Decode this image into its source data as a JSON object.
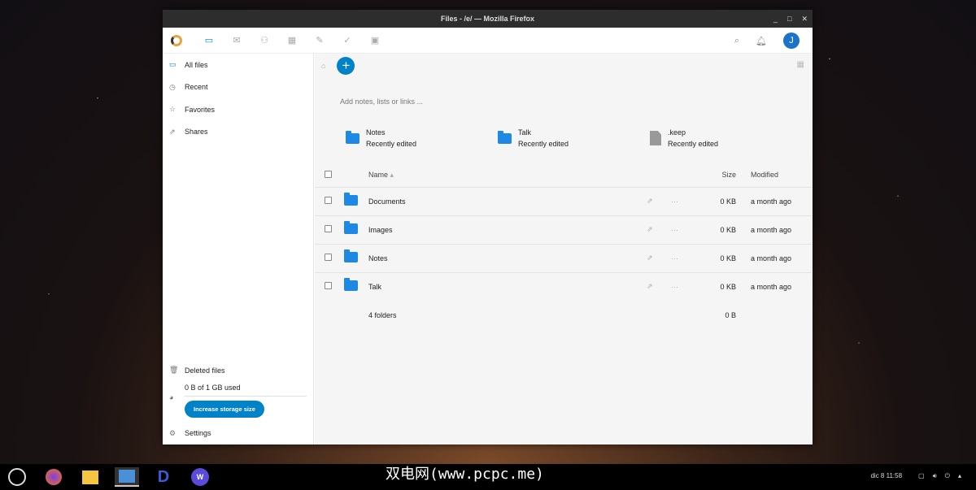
{
  "window": {
    "title": "Files - /e/ — Mozilla Firefox",
    "minimize": "_",
    "maximize": "□",
    "close": "✕"
  },
  "header": {
    "apps": [
      "files",
      "mail",
      "contacts",
      "calendar",
      "notes",
      "tasks",
      "photos"
    ],
    "avatar": "J"
  },
  "sidebar": {
    "items": [
      {
        "label": "All files",
        "icon": "folder-icon"
      },
      {
        "label": "Recent",
        "icon": "clock-icon"
      },
      {
        "label": "Favorites",
        "icon": "star-icon"
      },
      {
        "label": "Shares",
        "icon": "share-icon"
      }
    ],
    "deleted": "Deleted files",
    "quota": "0 B of 1 GB used",
    "increase": "Increase storage size",
    "settings": "Settings"
  },
  "main": {
    "notes_placeholder": "Add notes, lists or links ...",
    "recent": [
      {
        "name": "Notes",
        "sub": "Recently edited",
        "type": "folder"
      },
      {
        "name": "Talk",
        "sub": "Recently edited",
        "type": "folder"
      },
      {
        "name": ".keep",
        "sub": "Recently edited",
        "type": "file"
      }
    ],
    "columns": {
      "name": "Name",
      "size": "Size",
      "modified": "Modified"
    },
    "rows": [
      {
        "name": "Documents",
        "size": "0 KB",
        "modified": "a month ago"
      },
      {
        "name": "Images",
        "size": "0 KB",
        "modified": "a month ago"
      },
      {
        "name": "Notes",
        "size": "0 KB",
        "modified": "a month ago"
      },
      {
        "name": "Talk",
        "size": "0 KB",
        "modified": "a month ago"
      }
    ],
    "summary": {
      "count": "4 folders",
      "size": "0 B"
    }
  },
  "taskbar": {
    "watermark": "双电网(www.pcpc.me)",
    "date": "dic 8",
    "time": "11:58"
  }
}
